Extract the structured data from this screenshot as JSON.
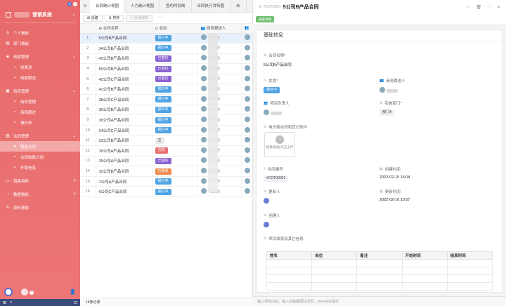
{
  "window": {
    "badges": [
      "8",
      "2"
    ]
  },
  "sidebar": {
    "title": "营销系统",
    "items": [
      {
        "label": "个人看板",
        "icon": "user-icon",
        "level": "top"
      },
      {
        "label": "部门看板",
        "icon": "chart-icon",
        "level": "top"
      },
      {
        "label": "线索管理",
        "icon": "lead-icon",
        "level": "group",
        "arrow": "⌄"
      },
      {
        "label": "线索池",
        "icon": "",
        "level": "sub"
      },
      {
        "label": "线索跟进",
        "icon": "",
        "level": "sub"
      },
      {
        "label": "商机管理",
        "icon": "briefcase-icon",
        "level": "group",
        "arrow": "⌄"
      },
      {
        "label": "商机管理",
        "icon": "",
        "level": "sub"
      },
      {
        "label": "商机跟进",
        "icon": "",
        "level": "sub"
      },
      {
        "label": "报价单",
        "icon": "",
        "level": "sub"
      },
      {
        "label": "合同管理",
        "icon": "contract-icon",
        "level": "group",
        "arrow": "⌄"
      },
      {
        "label": "销售合同",
        "icon": "",
        "level": "sub-active",
        "arrow": "···"
      },
      {
        "label": "合同收款计划",
        "icon": "",
        "level": "sub"
      },
      {
        "label": "开票信息",
        "icon": "",
        "level": "sub"
      },
      {
        "label": "销售资料",
        "icon": "folder-icon",
        "level": "group",
        "arrow": ">"
      },
      {
        "label": "数据看板",
        "icon": "dashboard-icon",
        "level": "group",
        "arrow": ">"
      },
      {
        "label": "资料搜索",
        "icon": "search-icon",
        "level": "group"
      }
    ]
  },
  "list": {
    "tabs": [
      "合同统计视图",
      "人力统计视图",
      "签约时间线",
      "合同执行甘特图",
      "未"
    ],
    "toolbar": {
      "create": "创建",
      "sort": "排序",
      "batch_edit": "批量编辑",
      "more": "···"
    },
    "columns": [
      "合同名称",
      "状态",
      "商务跟进人",
      ""
    ],
    "rows": [
      {
        "no": "1",
        "name": "5公司B产品合同",
        "status": "报价中",
        "color": "#4fa3e3"
      },
      {
        "no": "2",
        "name": "34公司B产品合同",
        "status": "报价中",
        "color": "#4fa3e3"
      },
      {
        "no": "3",
        "name": "43公司B产品合同",
        "status": "已签约",
        "color": "#8a63d2"
      },
      {
        "no": "4",
        "name": "50公司B产品合同",
        "status": "已签约",
        "color": "#8a63d2"
      },
      {
        "no": "5",
        "name": "42公司C产品合同",
        "status": "已签约",
        "color": "#8a63d2"
      },
      {
        "no": "6",
        "name": "41公司B产品合同",
        "status": "报价中",
        "color": "#4fa3e3"
      },
      {
        "no": "7",
        "name": "38公司C产品合同",
        "status": "报价中",
        "color": "#4fa3e3"
      },
      {
        "no": "8",
        "name": "30公司B产品合同",
        "status": "报价中",
        "color": "#4fa3e3"
      },
      {
        "no": "9",
        "name": "36公司A产品合同",
        "status": "报价中",
        "color": "#4fa3e3"
      },
      {
        "no": "10",
        "name": "24公司C产品合同",
        "status": "报价中",
        "color": "#4fa3e3"
      },
      {
        "no": "11",
        "name": "23公司B产品合同",
        "status": "空",
        "color": "#e9e9e9"
      },
      {
        "no": "12",
        "name": "16公司A产品合同",
        "status": "已败",
        "color": "#e76f6f"
      },
      {
        "no": "13",
        "name": "15公司A产品合同",
        "status": "已签约",
        "color": "#8a63d2"
      },
      {
        "no": "14",
        "name": "10公司B产品合同",
        "status": "已丢单",
        "color": "#f08a4b"
      },
      {
        "no": "15",
        "name": "7公司A产品合同",
        "status": "报价中",
        "color": "#4fa3e3"
      },
      {
        "no": "16",
        "name": "6公司C产品合同",
        "status": "报价中",
        "color": "#4fa3e3"
      }
    ],
    "footer": "16条记录"
  },
  "detail": {
    "code_prefix": "#COT0001",
    "title": "5公司B产品合同",
    "actions": [
      "☆",
      "🗑",
      "···",
      "✕"
    ],
    "action_button": "查看详情",
    "section": "基础信息",
    "fields": {
      "contract_name_label": "合同名称*",
      "contract_name": "5公司B产品合同",
      "status_label": "状态*",
      "status": "报价中",
      "biz_follower_label": "商务跟进人",
      "project_lead_label": "项目负责人",
      "dept_label": "实施部门*",
      "dept": "部门A",
      "attachment_label": "电子版合同和其它附件",
      "upload_text": "拖拽/粘贴/点击上传",
      "contract_no_label": "合同编号",
      "contract_no": "#COT00001",
      "created_time_label": "创建时间",
      "created_time": "2022-02-15 15:04",
      "updater_label": "更新人",
      "updated_time_label": "更新时间",
      "updated_time": "2022-02-16 10:57",
      "creator_label": "创建人",
      "members_label": "项目成员及其它信息"
    },
    "member_columns": [
      "姓名",
      "岗位",
      "备注",
      "开始时间",
      "结束时间"
    ],
    "comment_placeholder": "输入评论内容，输入@提醒团队成员，ctrl+enter提交"
  }
}
